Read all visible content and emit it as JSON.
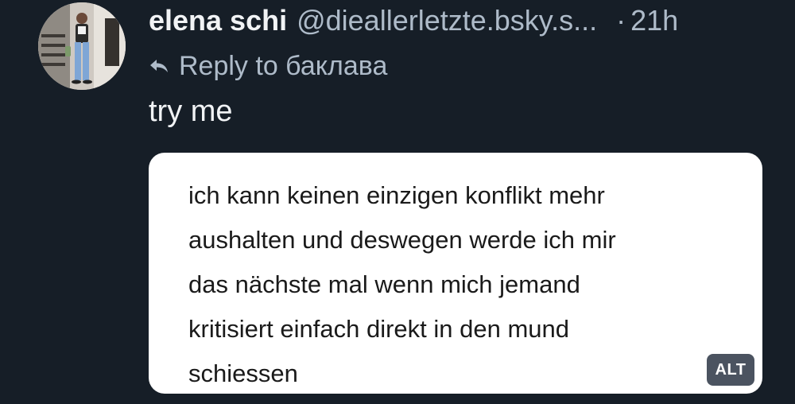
{
  "post": {
    "author": {
      "display_name": "elena schi",
      "handle": "@dieallerletzte.bsky.s...",
      "avatar_icon": "profile-photo-avatar"
    },
    "separator": "·",
    "timestamp": "21h",
    "reply": {
      "icon": "reply-arrow-icon",
      "label": "Reply to баклава"
    },
    "text": "try me",
    "embedded_image": {
      "lines": [
        "ich kann keinen einzigen konflikt mehr",
        "aushalten und deswegen werde ich mir",
        "das nächste mal wenn mich jemand",
        "kritisiert einfach direkt in den mund",
        "schiessen"
      ],
      "alt_badge": "ALT"
    }
  },
  "colors": {
    "background": "#161e27",
    "primary_text": "#f1f3f5",
    "secondary_text": "#aebbc9",
    "card_background": "#ffffff",
    "alt_badge_background": "#4b5360"
  }
}
